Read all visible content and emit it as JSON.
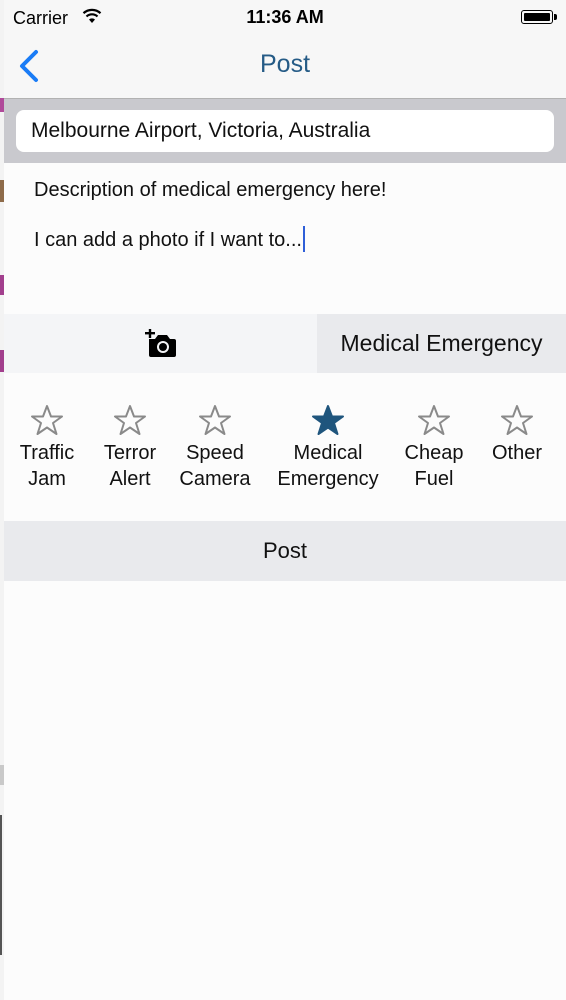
{
  "status_bar": {
    "carrier": "Carrier",
    "time": "11:36 AM",
    "wifi_icon": "wifi-icon",
    "battery_icon": "battery-icon"
  },
  "nav": {
    "title": "Post",
    "back_icon": "chevron-left-icon"
  },
  "location": {
    "value": "Melbourne Airport, Victoria, Australia"
  },
  "description": {
    "line1": "Description of medical emergency here!",
    "line2": "I can add a photo if I want to..."
  },
  "media": {
    "camera_icon": "add-photo-icon",
    "selected_category": "Medical Emergency"
  },
  "categories": [
    {
      "line1": "Traffic",
      "line2": "Jam",
      "selected": false
    },
    {
      "line1": "Terror",
      "line2": "Alert",
      "selected": false
    },
    {
      "line1": "Speed",
      "line2": "Camera",
      "selected": false
    },
    {
      "line1": "Medical",
      "line2": "Emergency",
      "selected": true
    },
    {
      "line1": "Cheap",
      "line2": "Fuel",
      "selected": false
    },
    {
      "line1": "Other",
      "line2": "",
      "selected": false
    }
  ],
  "post_button": {
    "label": "Post"
  },
  "colors": {
    "accent_blue": "#1a7cf6",
    "title_blue": "#255b86",
    "selected_star": "#1f557d",
    "unselected_star": "#8a8a8a"
  }
}
